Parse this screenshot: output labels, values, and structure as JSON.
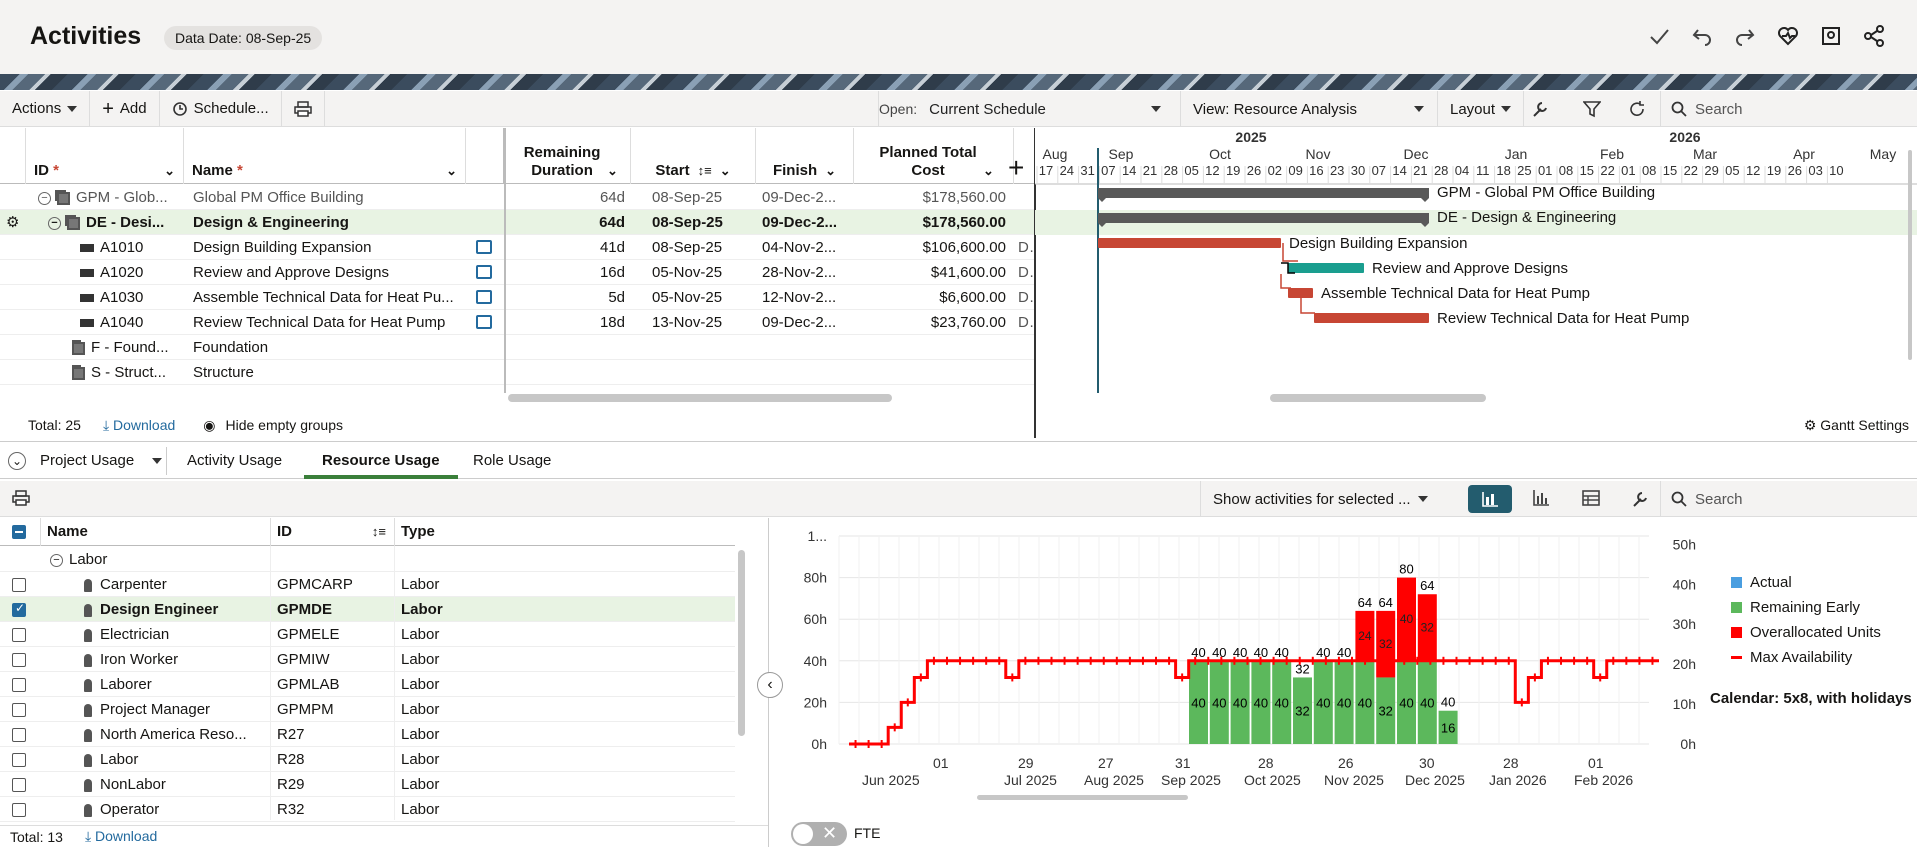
{
  "header": {
    "title": "Activities",
    "data_date": "Data Date: 08-Sep-25"
  },
  "toolbar": {
    "actions": "Actions",
    "add": "Add",
    "schedule": "Schedule...",
    "open_label": "Open:",
    "open_value": "Current Schedule",
    "view": "View: Resource Analysis",
    "layout": "Layout",
    "search_placeholder": "Search"
  },
  "grid": {
    "columns": {
      "id": "ID",
      "name": "Name",
      "remaining": "Remaining Duration",
      "start": "Start",
      "finish": "Finish",
      "cost": "Planned Total Cost"
    },
    "rows": [
      {
        "id": "GPM - Glob...",
        "name": "Global PM Office Building",
        "rem": "64d",
        "start": "08-Sep-25",
        "finish": "09-Dec-2...",
        "cost": "$178,560.00",
        "extra": ""
      },
      {
        "id": "DE - Desi...",
        "name": "Design & Engineering",
        "rem": "64d",
        "start": "08-Sep-25",
        "finish": "09-Dec-2...",
        "cost": "$178,560.00",
        "extra": ""
      },
      {
        "id": "A1010",
        "name": "Design Building Expansion",
        "rem": "41d",
        "start": "08-Sep-25",
        "finish": "04-Nov-2...",
        "cost": "$106,600.00",
        "extra": "De"
      },
      {
        "id": "A1020",
        "name": "Review and Approve Designs",
        "rem": "16d",
        "start": "05-Nov-25",
        "finish": "28-Nov-2...",
        "cost": "$41,600.00",
        "extra": "De"
      },
      {
        "id": "A1030",
        "name": "Assemble Technical Data for Heat Pu...",
        "rem": "5d",
        "start": "05-Nov-25",
        "finish": "12-Nov-2...",
        "cost": "$6,600.00",
        "extra": "De"
      },
      {
        "id": "A1040",
        "name": "Review Technical Data for Heat Pump",
        "rem": "18d",
        "start": "13-Nov-25",
        "finish": "09-Dec-2...",
        "cost": "$23,760.00",
        "extra": "De"
      },
      {
        "id": "F - Found...",
        "name": "Foundation",
        "rem": "",
        "start": "",
        "finish": "",
        "cost": "",
        "extra": ""
      },
      {
        "id": "S - Struct...",
        "name": "Structure",
        "rem": "",
        "start": "",
        "finish": "",
        "cost": "",
        "extra": ""
      }
    ],
    "footer": {
      "total": "Total: 25",
      "download": "Download",
      "hide_empty": "Hide empty groups",
      "gantt_settings": "Gantt Settings"
    }
  },
  "gantt": {
    "years": [
      "2025",
      "2026"
    ],
    "months": [
      "Aug",
      "Sep",
      "Oct",
      "Nov",
      "Dec",
      "Jan",
      "Feb",
      "Mar",
      "Apr",
      "May"
    ],
    "weeks": [
      "17",
      "24",
      "31",
      "07",
      "14",
      "21",
      "28",
      "05",
      "12",
      "19",
      "26",
      "02",
      "09",
      "16",
      "23",
      "30",
      "07",
      "14",
      "21",
      "28",
      "04",
      "11",
      "18",
      "25",
      "01",
      "08",
      "15",
      "22",
      "01",
      "08",
      "15",
      "22",
      "29",
      "05",
      "12",
      "19",
      "26",
      "03",
      "10"
    ],
    "bars": [
      {
        "label": "GPM - Global PM Office Building",
        "color": "#595959"
      },
      {
        "label": "DE - Design & Engineering",
        "color": "#595959"
      },
      {
        "label": "Design Building Expansion",
        "color": "#c74634"
      },
      {
        "label": "Review and Approve Designs",
        "color": "#1a9e8f"
      },
      {
        "label": "Assemble Technical Data for Heat Pump",
        "color": "#c74634"
      },
      {
        "label": "Review Technical Data for Heat Pump",
        "color": "#c74634"
      }
    ]
  },
  "usage_tabs": {
    "dropdown": "Project Usage",
    "tabs": [
      "Activity Usage",
      "Resource Usage",
      "Role Usage"
    ]
  },
  "bottom_toolbar": {
    "show_activities": "Show activities for selected ...",
    "search_placeholder": "Search"
  },
  "resources": {
    "columns": {
      "name": "Name",
      "id": "ID",
      "type": "Type"
    },
    "group": "Labor",
    "rows": [
      {
        "name": "Carpenter",
        "id": "GPMCARP",
        "type": "Labor",
        "checked": false
      },
      {
        "name": "Design Engineer",
        "id": "GPMDE",
        "type": "Labor",
        "checked": true
      },
      {
        "name": "Electrician",
        "id": "GPMELE",
        "type": "Labor",
        "checked": false
      },
      {
        "name": "Iron Worker",
        "id": "GPMIW",
        "type": "Labor",
        "checked": false
      },
      {
        "name": "Laborer",
        "id": "GPMLAB",
        "type": "Labor",
        "checked": false
      },
      {
        "name": "Project Manager",
        "id": "GPMPM",
        "type": "Labor",
        "checked": false
      },
      {
        "name": "North America Reso...",
        "id": "R27",
        "type": "Labor",
        "checked": false
      },
      {
        "name": "Labor",
        "id": "R28",
        "type": "Labor",
        "checked": false
      },
      {
        "name": "NonLabor",
        "id": "R29",
        "type": "Labor",
        "checked": false
      },
      {
        "name": "Operator",
        "id": "R32",
        "type": "Labor",
        "checked": false
      }
    ],
    "footer": {
      "total": "Total: 13",
      "download": "Download"
    }
  },
  "chart_data": {
    "type": "bar",
    "y_left_ticks": [
      "0h",
      "20h",
      "40h",
      "60h",
      "80h",
      "1..."
    ],
    "y_right_ticks": [
      "0h",
      "10h",
      "20h",
      "30h",
      "40h",
      "50h"
    ],
    "ylim": [
      0,
      100
    ],
    "x_ticks": [
      {
        "day": "",
        "month": "Jun 2025"
      },
      {
        "day": "01",
        "month": ""
      },
      {
        "day": "29",
        "month": "Jul 2025"
      },
      {
        "day": "27",
        "month": "Aug 2025"
      },
      {
        "day": "31",
        "month": "Sep 2025"
      },
      {
        "day": "28",
        "month": "Oct 2025"
      },
      {
        "day": "26",
        "month": "Nov 2025"
      },
      {
        "day": "30",
        "month": "Dec 2025"
      },
      {
        "day": "28",
        "month": "Jan 2026"
      },
      {
        "day": "01",
        "month": "Feb 2026"
      }
    ],
    "series": [
      {
        "name": "Remaining Early",
        "color": "#5cb85c",
        "values": [
          40,
          40,
          40,
          40,
          40,
          32,
          40,
          40,
          40,
          32,
          40,
          40,
          16
        ]
      },
      {
        "name": "Overallocated Units",
        "color": "#ff0000",
        "values": [
          0,
          0,
          0,
          0,
          0,
          0,
          0,
          0,
          24,
          32,
          40,
          32,
          0
        ]
      }
    ],
    "top_labels": [
      "40",
      "40",
      "40",
      "40",
      "40",
      "32",
      "40",
      "40",
      "64",
      "64",
      "80",
      "64",
      "40"
    ],
    "extra_bar_label": "16",
    "max_availability": [
      0,
      0,
      0,
      8,
      20,
      32,
      40,
      40,
      40,
      40,
      40,
      40,
      32,
      40,
      40,
      40,
      40,
      40,
      40,
      40,
      40,
      40,
      40,
      40,
      40,
      32,
      40,
      40,
      40,
      40,
      40,
      40,
      40,
      40,
      40,
      40,
      40,
      40,
      40,
      40,
      40,
      40,
      40,
      40,
      40,
      40,
      40,
      40,
      40,
      40,
      40,
      20,
      32,
      40,
      40,
      40,
      40,
      32,
      40,
      40,
      40,
      40
    ],
    "legend": [
      {
        "name": "Actual",
        "color": "#4a9ee0"
      },
      {
        "name": "Remaining Early",
        "color": "#5cb85c"
      },
      {
        "name": "Overallocated Units",
        "color": "#ff0000"
      },
      {
        "name": "Max Availability",
        "color": "#ff0000"
      }
    ],
    "calendar": "Calendar: 5x8, with holidays"
  },
  "fte_label": "FTE"
}
